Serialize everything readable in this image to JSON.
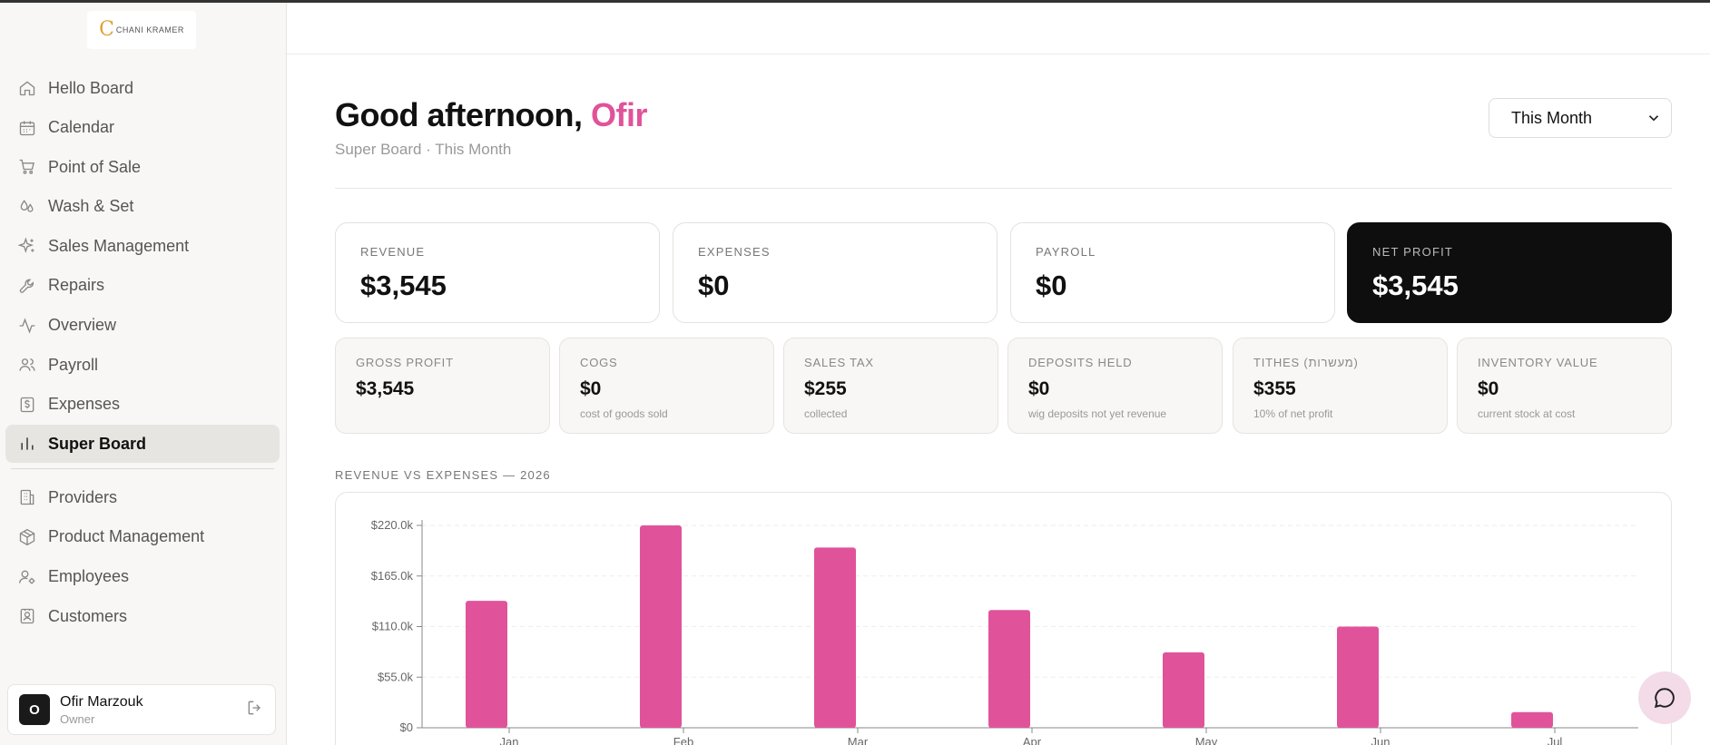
{
  "logo": {
    "text": "CHANI KRAMER"
  },
  "sidebar": {
    "items": [
      {
        "label": "Hello Board",
        "icon": "home-icon",
        "active": false
      },
      {
        "label": "Calendar",
        "icon": "calendar-icon",
        "active": false
      },
      {
        "label": "Point of Sale",
        "icon": "cart-icon",
        "active": false
      },
      {
        "label": "Wash & Set",
        "icon": "droplets-icon",
        "active": false
      },
      {
        "label": "Sales Management",
        "icon": "sparkles-icon",
        "active": false
      },
      {
        "label": "Repairs",
        "icon": "wrench-icon",
        "active": false
      },
      {
        "label": "Overview",
        "icon": "activity-icon",
        "active": false
      },
      {
        "label": "Payroll",
        "icon": "users-icon",
        "active": false
      },
      {
        "label": "Expenses",
        "icon": "receipt-icon",
        "active": false
      },
      {
        "label": "Super Board",
        "icon": "bar-chart-icon",
        "active": true
      }
    ],
    "secondary_items": [
      {
        "label": "Providers",
        "icon": "building-icon"
      },
      {
        "label": "Product Management",
        "icon": "package-icon"
      },
      {
        "label": "Employees",
        "icon": "user-cog-icon"
      },
      {
        "label": "Customers",
        "icon": "contact-icon"
      }
    ],
    "user": {
      "initial": "O",
      "name": "Ofir Marzouk",
      "role": "Owner"
    }
  },
  "header": {
    "greeting": "Good afternoon,",
    "name": "Ofir",
    "subtitle": "Super Board · This Month",
    "period": "This Month"
  },
  "kpis": [
    {
      "label": "REVENUE",
      "value": "$3,545"
    },
    {
      "label": "EXPENSES",
      "value": "$0"
    },
    {
      "label": "PAYROLL",
      "value": "$0"
    },
    {
      "label": "NET PROFIT",
      "value": "$3,545"
    }
  ],
  "metrics": [
    {
      "label": "GROSS PROFIT",
      "value": "$3,545",
      "note": ""
    },
    {
      "label": "COGS",
      "value": "$0",
      "note": "cost of goods sold"
    },
    {
      "label": "SALES TAX",
      "value": "$255",
      "note": "collected"
    },
    {
      "label": "DEPOSITS HELD",
      "value": "$0",
      "note": "wig deposits not yet revenue"
    },
    {
      "label": "TITHES (מעשרות)",
      "value": "$355",
      "note": "10% of net profit"
    },
    {
      "label": "INVENTORY VALUE",
      "value": "$0",
      "note": "current stock at cost"
    }
  ],
  "chart_title": "REVENUE VS EXPENSES — 2026",
  "chart_data": {
    "type": "bar",
    "categories": [
      "Jan",
      "Feb",
      "Mar",
      "Apr",
      "May",
      "Jun",
      "Jul"
    ],
    "series": [
      {
        "values": [
          138000,
          220000,
          196000,
          128000,
          82000,
          110000,
          17000
        ],
        "color": "#e0539a"
      },
      {
        "values": [
          0,
          0,
          0,
          0,
          0,
          0,
          0
        ],
        "color": "#222222"
      }
    ],
    "yticks": [
      "$0",
      "$55.0k",
      "$110.0k",
      "$165.0k",
      "$220.0k"
    ],
    "ylim": [
      0,
      220000
    ],
    "grid": true
  }
}
